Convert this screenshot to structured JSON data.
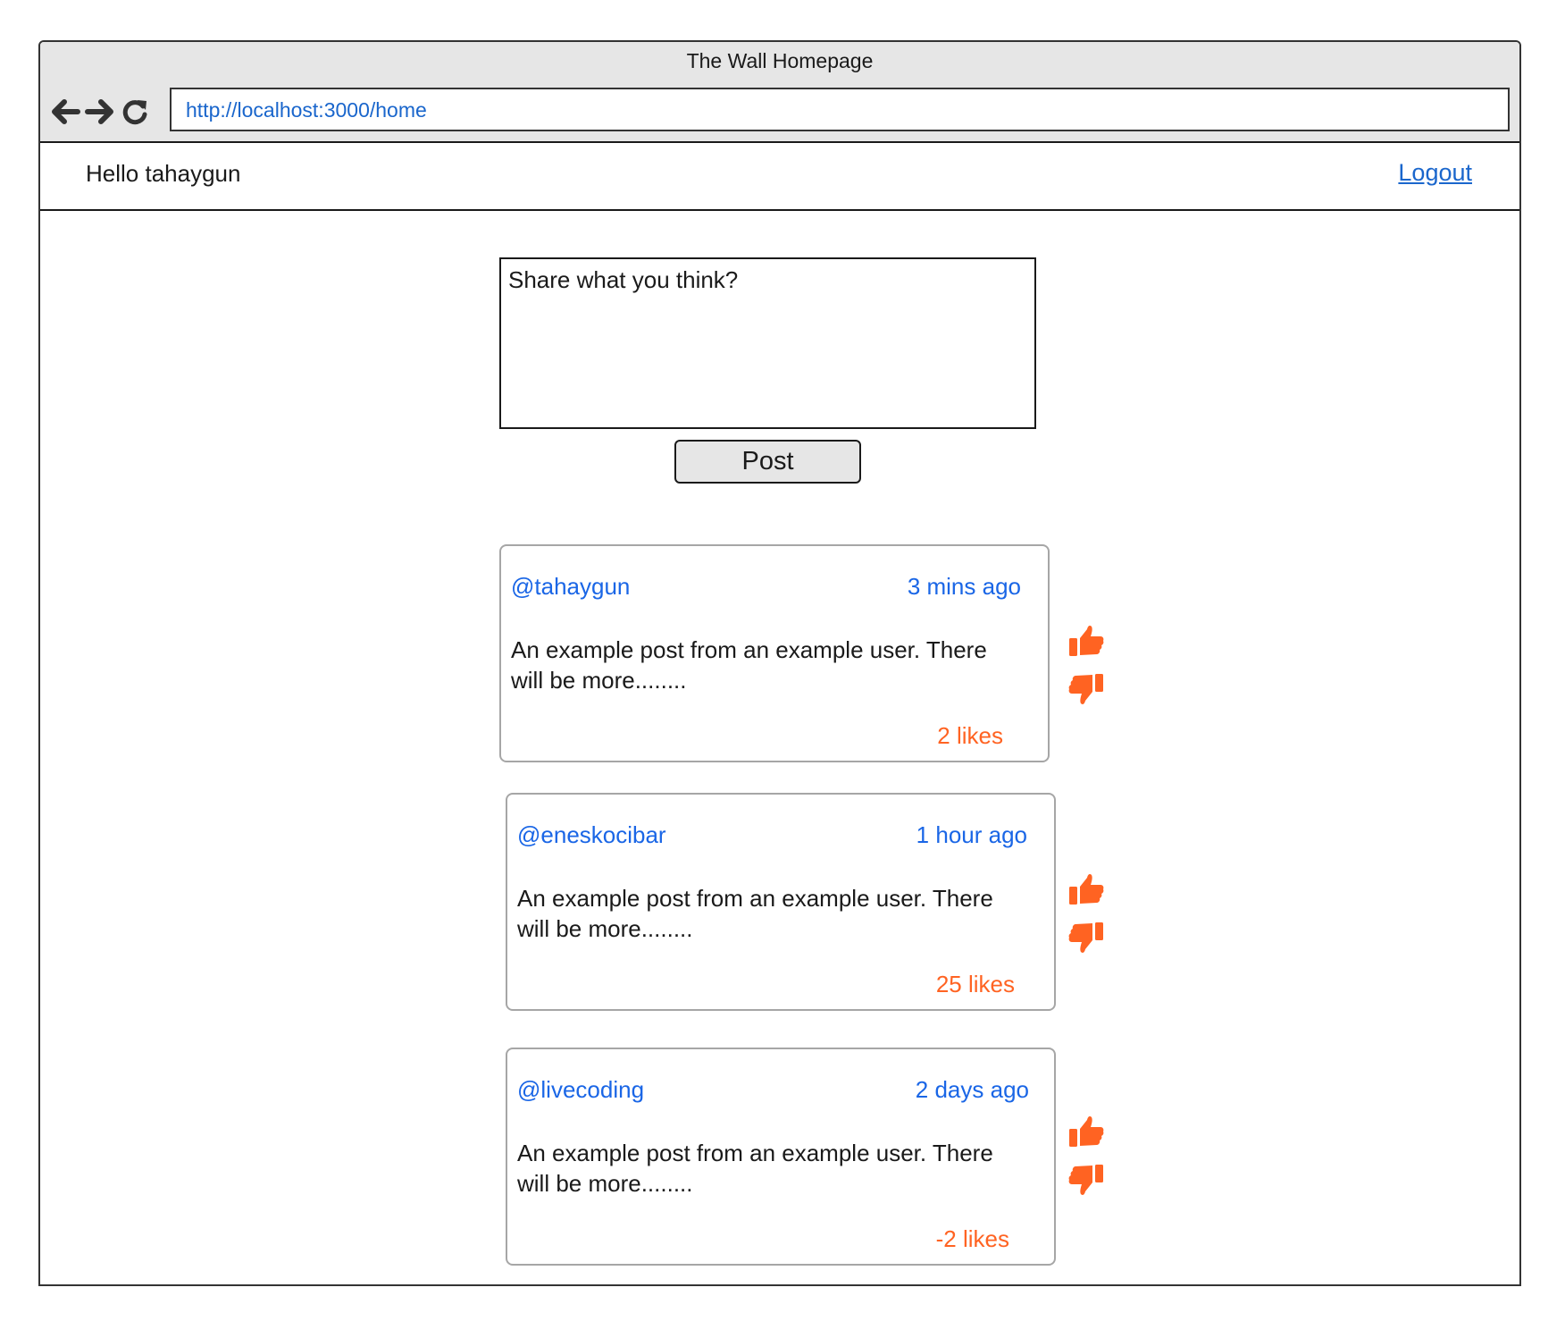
{
  "window": {
    "title": "The Wall Homepage",
    "url": "http://localhost:3000/home"
  },
  "header": {
    "greeting": "Hello tahaygun",
    "logout_label": "Logout"
  },
  "composer": {
    "placeholder": "Share what you think?",
    "post_label": "Post"
  },
  "posts": [
    {
      "user": "@tahaygun",
      "time": "3 mins ago",
      "body": "An example post from an example user. There will be more........",
      "likes": "2 likes"
    },
    {
      "user": "@eneskocibar",
      "time": "1 hour ago",
      "body": "An example post from an example user. There will be more........",
      "likes": "25 likes"
    },
    {
      "user": "@livecoding",
      "time": "2 days ago",
      "body": "An example post from an example user. There will be more........",
      "likes": "-2 likes"
    }
  ],
  "colors": {
    "accent": "#ff6322",
    "link": "#1a66e6",
    "chrome": "#e6e6e6"
  },
  "icons": {
    "back": "arrow-left-icon",
    "forward": "arrow-right-icon",
    "reload": "reload-icon",
    "like": "thumbs-up-icon",
    "dislike": "thumbs-down-icon"
  }
}
